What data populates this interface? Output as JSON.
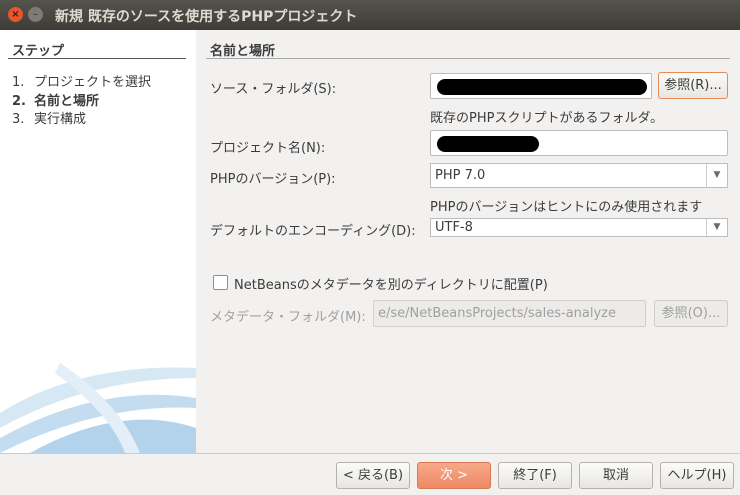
{
  "window": {
    "title": "新規 既存のソースを使用するPHPプロジェクト"
  },
  "steps": {
    "title": "ステップ",
    "items": [
      {
        "num": "1.",
        "label": "プロジェクトを選択"
      },
      {
        "num": "2.",
        "label": "名前と場所"
      },
      {
        "num": "3.",
        "label": "実行構成"
      }
    ]
  },
  "panel": {
    "title": "名前と場所",
    "source_folder_label": "ソース・フォルダ(S):",
    "browse_label": "参照(R)...",
    "source_hint": "既存のPHPスクリプトがあるフォルダ。",
    "project_name_label": "プロジェクト名(N):",
    "php_version_label": "PHPのバージョン(P):",
    "php_version_value": "PHP 7.0",
    "php_version_hint": "PHPのバージョンはヒントにのみ使用されます",
    "encoding_label": "デフォルトのエンコーディング(D):",
    "encoding_value": "UTF-8",
    "metadata_checkbox_label": "NetBeansのメタデータを別のディレクトリに配置(P)",
    "metadata_folder_label": "メタデータ・フォルダ(M):",
    "metadata_folder_value": "e/se/NetBeansProjects/sales-analyze",
    "metadata_browse_label": "参照(O)..."
  },
  "footer": {
    "back": "< 戻る(B)",
    "next": "次 >",
    "finish": "終了(F)",
    "cancel": "取消",
    "help": "ヘルプ(H)"
  },
  "colors": {
    "accent": "#ee8864",
    "titlebar": "#3d3c37",
    "close": "#e8562a"
  }
}
